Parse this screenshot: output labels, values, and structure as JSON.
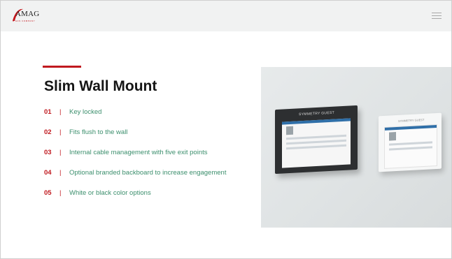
{
  "header": {
    "logo": {
      "wordmark": "AMAG",
      "tagline": "A G4S COMPANY"
    },
    "menu_icon": "hamburger-menu-icon"
  },
  "main": {
    "title": "Slim Wall Mount",
    "features": [
      {
        "num": "01",
        "sep": "|",
        "text": "Key locked"
      },
      {
        "num": "02",
        "sep": "|",
        "text": "Fits flush to the wall"
      },
      {
        "num": "03",
        "sep": "|",
        "text": "Internal cable management with five exit points"
      },
      {
        "num": "04",
        "sep": "|",
        "text": "Optional branded backboard to increase engagement"
      },
      {
        "num": "05",
        "sep": "|",
        "text": "White or black color options"
      }
    ]
  },
  "product_image": {
    "black_device_brand": "SYMMETRY GUEST",
    "white_device_brand": "SYMMETRY GUEST"
  },
  "colors": {
    "accent": "#c0191f",
    "feature_text": "#3c8f6d",
    "header_bg": "#f1f2f2"
  }
}
